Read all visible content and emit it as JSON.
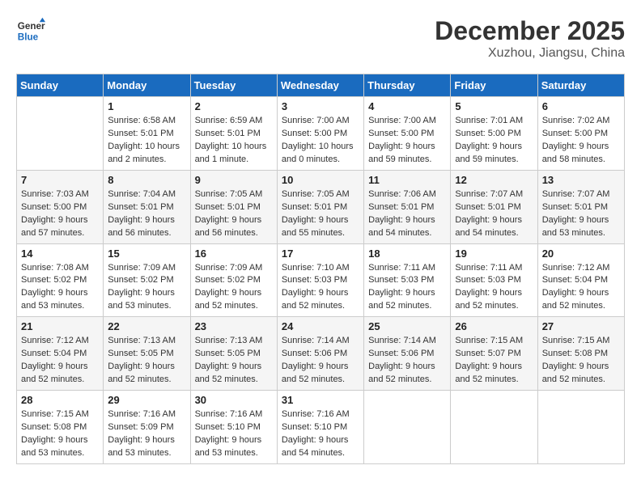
{
  "logo": {
    "general": "General",
    "blue": "Blue"
  },
  "title": "December 2025",
  "subtitle": "Xuzhou, Jiangsu, China",
  "weekdays": [
    "Sunday",
    "Monday",
    "Tuesday",
    "Wednesday",
    "Thursday",
    "Friday",
    "Saturday"
  ],
  "weeks": [
    [
      {
        "day": null
      },
      {
        "day": "1",
        "sunrise": "6:58 AM",
        "sunset": "5:01 PM",
        "daylight": "10 hours and 2 minutes."
      },
      {
        "day": "2",
        "sunrise": "6:59 AM",
        "sunset": "5:01 PM",
        "daylight": "10 hours and 1 minute."
      },
      {
        "day": "3",
        "sunrise": "7:00 AM",
        "sunset": "5:00 PM",
        "daylight": "10 hours and 0 minutes."
      },
      {
        "day": "4",
        "sunrise": "7:00 AM",
        "sunset": "5:00 PM",
        "daylight": "9 hours and 59 minutes."
      },
      {
        "day": "5",
        "sunrise": "7:01 AM",
        "sunset": "5:00 PM",
        "daylight": "9 hours and 59 minutes."
      },
      {
        "day": "6",
        "sunrise": "7:02 AM",
        "sunset": "5:00 PM",
        "daylight": "9 hours and 58 minutes."
      }
    ],
    [
      {
        "day": "7",
        "sunrise": "7:03 AM",
        "sunset": "5:00 PM",
        "daylight": "9 hours and 57 minutes."
      },
      {
        "day": "8",
        "sunrise": "7:04 AM",
        "sunset": "5:01 PM",
        "daylight": "9 hours and 56 minutes."
      },
      {
        "day": "9",
        "sunrise": "7:05 AM",
        "sunset": "5:01 PM",
        "daylight": "9 hours and 56 minutes."
      },
      {
        "day": "10",
        "sunrise": "7:05 AM",
        "sunset": "5:01 PM",
        "daylight": "9 hours and 55 minutes."
      },
      {
        "day": "11",
        "sunrise": "7:06 AM",
        "sunset": "5:01 PM",
        "daylight": "9 hours and 54 minutes."
      },
      {
        "day": "12",
        "sunrise": "7:07 AM",
        "sunset": "5:01 PM",
        "daylight": "9 hours and 54 minutes."
      },
      {
        "day": "13",
        "sunrise": "7:07 AM",
        "sunset": "5:01 PM",
        "daylight": "9 hours and 53 minutes."
      }
    ],
    [
      {
        "day": "14",
        "sunrise": "7:08 AM",
        "sunset": "5:02 PM",
        "daylight": "9 hours and 53 minutes."
      },
      {
        "day": "15",
        "sunrise": "7:09 AM",
        "sunset": "5:02 PM",
        "daylight": "9 hours and 53 minutes."
      },
      {
        "day": "16",
        "sunrise": "7:09 AM",
        "sunset": "5:02 PM",
        "daylight": "9 hours and 52 minutes."
      },
      {
        "day": "17",
        "sunrise": "7:10 AM",
        "sunset": "5:03 PM",
        "daylight": "9 hours and 52 minutes."
      },
      {
        "day": "18",
        "sunrise": "7:11 AM",
        "sunset": "5:03 PM",
        "daylight": "9 hours and 52 minutes."
      },
      {
        "day": "19",
        "sunrise": "7:11 AM",
        "sunset": "5:03 PM",
        "daylight": "9 hours and 52 minutes."
      },
      {
        "day": "20",
        "sunrise": "7:12 AM",
        "sunset": "5:04 PM",
        "daylight": "9 hours and 52 minutes."
      }
    ],
    [
      {
        "day": "21",
        "sunrise": "7:12 AM",
        "sunset": "5:04 PM",
        "daylight": "9 hours and 52 minutes."
      },
      {
        "day": "22",
        "sunrise": "7:13 AM",
        "sunset": "5:05 PM",
        "daylight": "9 hours and 52 minutes."
      },
      {
        "day": "23",
        "sunrise": "7:13 AM",
        "sunset": "5:05 PM",
        "daylight": "9 hours and 52 minutes."
      },
      {
        "day": "24",
        "sunrise": "7:14 AM",
        "sunset": "5:06 PM",
        "daylight": "9 hours and 52 minutes."
      },
      {
        "day": "25",
        "sunrise": "7:14 AM",
        "sunset": "5:06 PM",
        "daylight": "9 hours and 52 minutes."
      },
      {
        "day": "26",
        "sunrise": "7:15 AM",
        "sunset": "5:07 PM",
        "daylight": "9 hours and 52 minutes."
      },
      {
        "day": "27",
        "sunrise": "7:15 AM",
        "sunset": "5:08 PM",
        "daylight": "9 hours and 52 minutes."
      }
    ],
    [
      {
        "day": "28",
        "sunrise": "7:15 AM",
        "sunset": "5:08 PM",
        "daylight": "9 hours and 53 minutes."
      },
      {
        "day": "29",
        "sunrise": "7:16 AM",
        "sunset": "5:09 PM",
        "daylight": "9 hours and 53 minutes."
      },
      {
        "day": "30",
        "sunrise": "7:16 AM",
        "sunset": "5:10 PM",
        "daylight": "9 hours and 53 minutes."
      },
      {
        "day": "31",
        "sunrise": "7:16 AM",
        "sunset": "5:10 PM",
        "daylight": "9 hours and 54 minutes."
      },
      {
        "day": null
      },
      {
        "day": null
      },
      {
        "day": null
      }
    ]
  ]
}
